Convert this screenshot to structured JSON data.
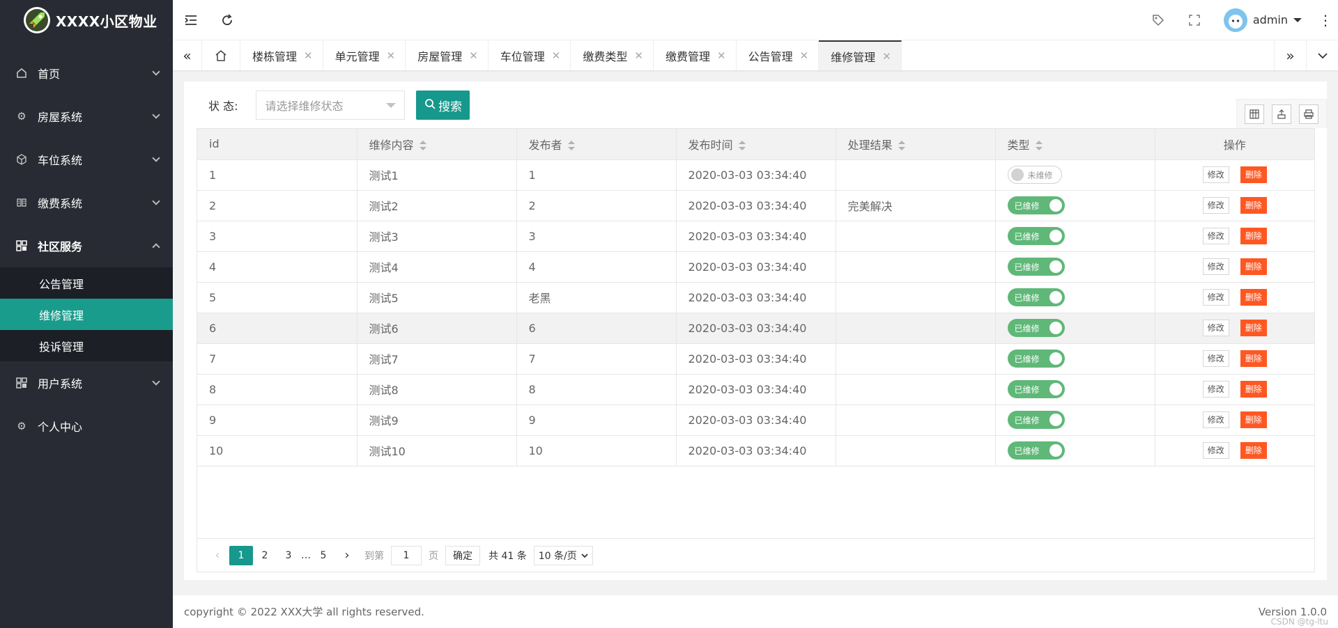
{
  "app": {
    "title": "XXXX小区物业"
  },
  "sidebar": {
    "items": [
      {
        "label": "首页",
        "icon": "home-icon"
      },
      {
        "label": "房屋系统",
        "icon": "gear-icon"
      },
      {
        "label": "车位系统",
        "icon": "cube-icon"
      },
      {
        "label": "缴费系统",
        "icon": "book-icon"
      },
      {
        "label": "社区服务",
        "icon": "grid-icon"
      },
      {
        "label": "用户系统",
        "icon": "grid-icon"
      },
      {
        "label": "个人中心",
        "icon": "gear-icon"
      }
    ],
    "subitems": [
      "公告管理",
      "维修管理",
      "投诉管理"
    ],
    "active_color": "#1a9c8c"
  },
  "header": {
    "user": "admin"
  },
  "tabs": [
    "楼栋管理",
    "单元管理",
    "房屋管理",
    "车位管理",
    "缴费类型",
    "缴费管理",
    "公告管理",
    "维修管理"
  ],
  "search": {
    "label": "状 态:",
    "placeholder": "请选择维修状态",
    "button": "搜索"
  },
  "table": {
    "columns": [
      "id",
      "维修内容",
      "发布者",
      "发布时间",
      "处理结果",
      "类型",
      "操作"
    ],
    "rows": [
      {
        "id": "1",
        "content": "测试1",
        "publisher": "1",
        "time": "2020-03-03 03:34:40",
        "result": "",
        "status": "未维修",
        "on": false
      },
      {
        "id": "2",
        "content": "测试2",
        "publisher": "2",
        "time": "2020-03-03 03:34:40",
        "result": "完美解决",
        "status": "已维修",
        "on": true
      },
      {
        "id": "3",
        "content": "测试3",
        "publisher": "3",
        "time": "2020-03-03 03:34:40",
        "result": "",
        "status": "已维修",
        "on": true
      },
      {
        "id": "4",
        "content": "测试4",
        "publisher": "4",
        "time": "2020-03-03 03:34:40",
        "result": "",
        "status": "已维修",
        "on": true
      },
      {
        "id": "5",
        "content": "测试5",
        "publisher": "老黑",
        "time": "2020-03-03 03:34:40",
        "result": "",
        "status": "已维修",
        "on": true
      },
      {
        "id": "6",
        "content": "测试6",
        "publisher": "6",
        "time": "2020-03-03 03:34:40",
        "result": "",
        "status": "已维修",
        "on": true
      },
      {
        "id": "7",
        "content": "测试7",
        "publisher": "7",
        "time": "2020-03-03 03:34:40",
        "result": "",
        "status": "已维修",
        "on": true
      },
      {
        "id": "8",
        "content": "测试8",
        "publisher": "8",
        "time": "2020-03-03 03:34:40",
        "result": "",
        "status": "已维修",
        "on": true
      },
      {
        "id": "9",
        "content": "测试9",
        "publisher": "9",
        "time": "2020-03-03 03:34:40",
        "result": "",
        "status": "已维修",
        "on": true
      },
      {
        "id": "10",
        "content": "测试10",
        "publisher": "10",
        "time": "2020-03-03 03:34:40",
        "result": "",
        "status": "已维修",
        "on": true
      }
    ],
    "edit_label": "修改",
    "delete_label": "删除"
  },
  "pager": {
    "pages": [
      "1",
      "2",
      "3",
      "…",
      "5"
    ],
    "current": "1",
    "goto_prefix": "到第",
    "goto_value": "1",
    "goto_suffix": "页",
    "confirm": "确定",
    "total": "共 41 条",
    "per_page": "10 条/页"
  },
  "footer": {
    "copyright": "copyright © 2022 XXX大学 all rights reserved.",
    "version": "Version 1.0.0",
    "watermark": "CSDN @tg-ltu"
  }
}
